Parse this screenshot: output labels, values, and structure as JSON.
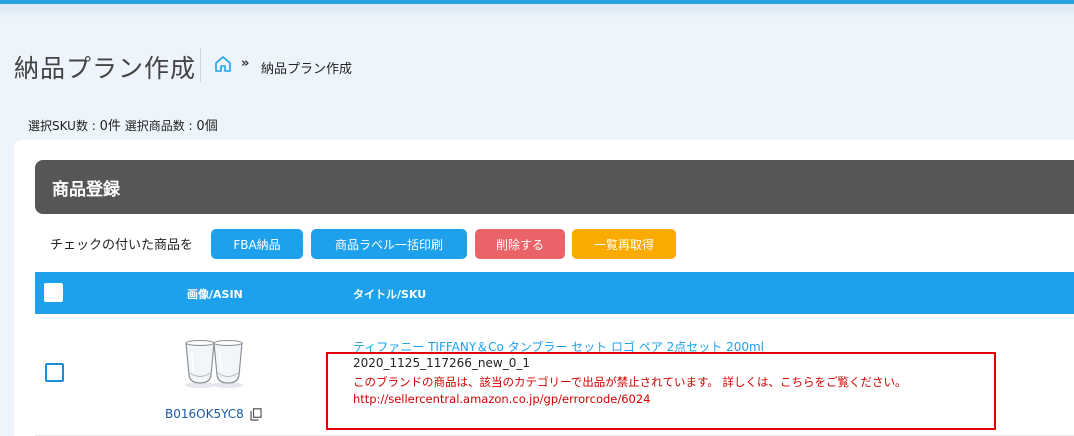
{
  "header": {
    "page_title": "納品プラン作成",
    "breadcrumb_sep": "»",
    "breadcrumb_current": "納品プラン作成"
  },
  "summary": {
    "sku_label": "選択SKU数 : ",
    "sku_count": "0件",
    "item_label": "選択商品数 : ",
    "item_count": "0個"
  },
  "section": {
    "title": "商品登録",
    "action_label": "チェックの付いた商品を",
    "buttons": {
      "fba": "FBA納品",
      "label_print": "商品ラベル一括印刷",
      "delete": "削除する",
      "refetch": "一覧再取得"
    }
  },
  "table": {
    "headers": {
      "image_asin": "画像/ASIN",
      "title_sku": "タイトル/SKU"
    },
    "rows": [
      {
        "asin": "B016OK5YC8",
        "title": "ティファニー TIFFANY＆Co タンブラー セット ロゴ ペア 2点セット 200ml",
        "sku": "2020_1125_117266_new_0_1",
        "error_message": "このブランドの商品は、該当のカテゴリーで出品が禁止されています。 詳しくは、こちらをご覧ください。",
        "error_url": "http://sellercentral.amazon.co.jp/gp/errorcode/6024"
      }
    ]
  },
  "colors": {
    "accent": "#1da1ec",
    "danger": "#ea6368",
    "warning": "#fbaa00",
    "section_header": "#565656",
    "error_text": "#d40000",
    "highlight_border": "#e00000"
  }
}
